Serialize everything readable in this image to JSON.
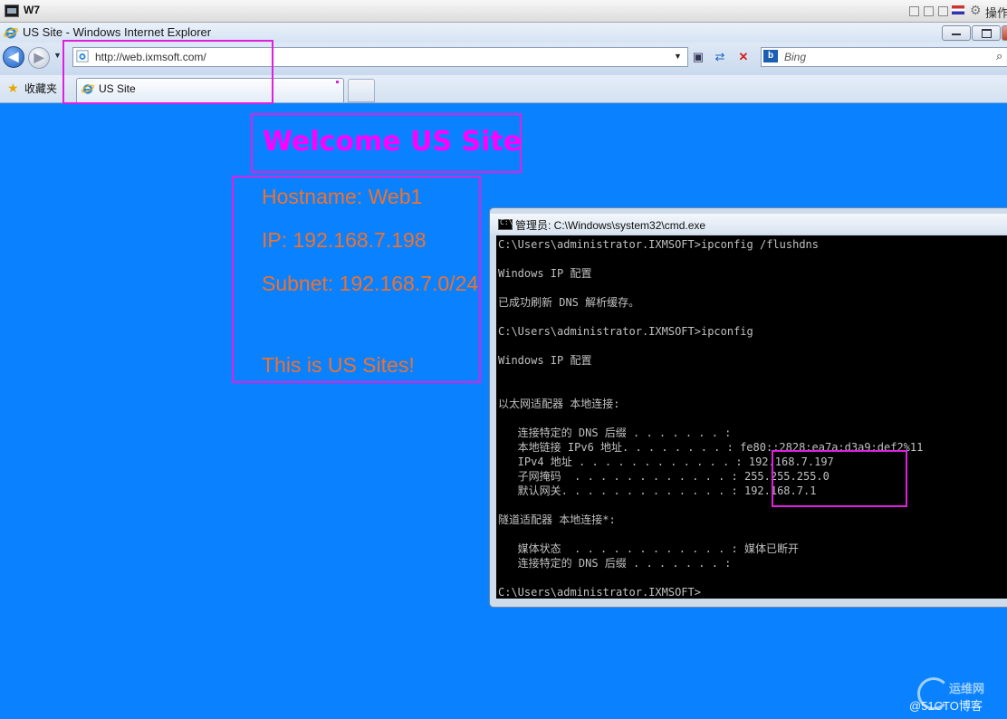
{
  "vm": {
    "title": "W7",
    "right_label": "操作"
  },
  "browser": {
    "window_title": "US Site - Windows Internet Explorer",
    "address": "http://web.ixmsoft.com/",
    "search_placeholder": "Bing",
    "favorites_label": "收藏夹",
    "tab_label": "US Site"
  },
  "page": {
    "heading": "Welcome US Site",
    "hostname": "Hostname: Web1",
    "ip": "IP: 192.168.7.198",
    "subnet": "Subnet: 192.168.7.0/24",
    "note": "This is US Sites!"
  },
  "cmd": {
    "title": "管理员: C:\\Windows\\system32\\cmd.exe",
    "lines": [
      "C:\\Users\\administrator.IXMSOFT>ipconfig /flushdns",
      "",
      "Windows IP 配置",
      "",
      "已成功刷新 DNS 解析缓存。",
      "",
      "C:\\Users\\administrator.IXMSOFT>ipconfig",
      "",
      "Windows IP 配置",
      "",
      "",
      "以太网适配器 本地连接:",
      "",
      "   连接特定的 DNS 后缀 . . . . . . . :",
      "   本地链接 IPv6 地址. . . . . . . . : fe80::2828:ea7a:d3a9:def2%11",
      "   IPv4 地址 . . . . . . . . . . . . : 192.168.7.197",
      "   子网掩码  . . . . . . . . . . . . : 255.255.255.0",
      "   默认网关. . . . . . . . . . . . . : 192.168.7.1",
      "",
      "隧道适配器 本地连接*:",
      "",
      "   媒体状态  . . . . . . . . . . . . : 媒体已断开",
      "   连接特定的 DNS 后缀 . . . . . . . :",
      "",
      "C:\\Users\\administrator.IXMSOFT>"
    ]
  },
  "watermark": {
    "top": "运维网",
    "bottom": "@51CTO博客"
  },
  "colors": {
    "page_bg": "#0a82ff",
    "heading": "#ff00ff",
    "info_text": "#f0712a",
    "highlight": "#e020e0"
  }
}
